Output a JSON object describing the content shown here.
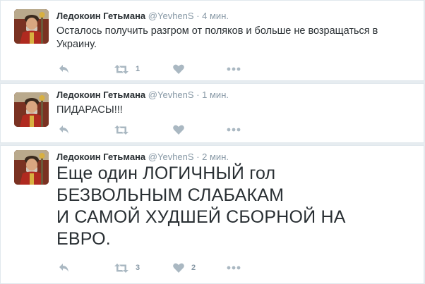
{
  "colors": {
    "background": "#e6ecf0",
    "card": "#ffffff",
    "name": "#292f33",
    "meta": "#8899a6",
    "icon": "#aab8c2"
  },
  "tweets": [
    {
      "author": "Ледокоин Гетьмана",
      "handle": "@YevhenS",
      "dot": "·",
      "time": "4 мин.",
      "text_lines": [
        "Осталось получить разгром от поляков и больше не возращаться в",
        "Украину."
      ],
      "retweets": "1",
      "likes": ""
    },
    {
      "author": "Ледокоин Гетьмана",
      "handle": "@YevhenS",
      "dot": "·",
      "time": "1 мин.",
      "text_lines": [
        "ПИДАРАСЫ!!!"
      ],
      "retweets": "",
      "likes": ""
    },
    {
      "author": "Ледокоин Гетьмана",
      "handle": "@YevhenS",
      "dot": "·",
      "time": "2 мин.",
      "text_lines": [
        "Еще один ЛОГИЧНЫЙ гол",
        "БЕЗВОЛЬНЫМ СЛАБАКАМ",
        "И САМОЙ ХУДШЕЙ СБОРНОЙ НА",
        "ЕВРО."
      ],
      "retweets": "3",
      "likes": "2"
    }
  ]
}
